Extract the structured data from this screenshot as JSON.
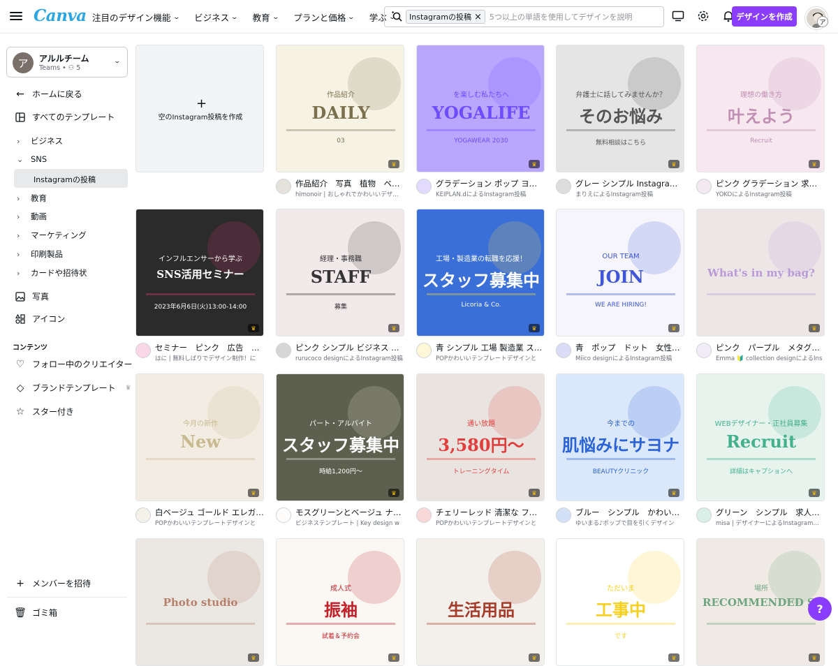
{
  "header": {
    "logo": "Canva",
    "nav": [
      "注目のデザイン機能",
      "ビジネス",
      "教育",
      "プランと価格",
      "学ぶ"
    ],
    "search_chip": "Instagramの投稿",
    "search_placeholder": "5つ以上の単語を使用してデザインを説明",
    "create_button": "デザインを作成",
    "avatar_badge": "ア"
  },
  "sidebar": {
    "team_initial": "ア",
    "team_name": "アルルチーム",
    "team_sub": "Teams • ",
    "team_members": "5",
    "back": "ホームに戻る",
    "all_templates": "すべてのテンプレート",
    "categories": [
      "ビジネス",
      "SNS"
    ],
    "active": "Instagramの投稿",
    "categories2": [
      "教育",
      "動画",
      "マーケティング",
      "印刷製品",
      "カードや招待状"
    ],
    "photos": "写真",
    "icons": "アイコン",
    "content_heading": "コンテンツ",
    "following": "フォロー中のクリエイター",
    "brand_templates": "ブランドテンプレート",
    "starred": "スター付き",
    "invite": "メンバーを招待",
    "trash": "ゴミ箱"
  },
  "blank": {
    "label": "空のInstagram投稿を作成"
  },
  "cards": [
    {
      "title": "作品紹介　写真　植物　ベージュ",
      "sub": "himonoir | おしゃれでかわいいデザイン",
      "bg": "#f6f3e4",
      "text": "DAILY",
      "sub_text": "作品紹介",
      "num": "03",
      "accent": "#7c6f4e"
    },
    {
      "title": "グラデーション ポップ ヨガ キャンペーン",
      "sub": "KEIPLAN.dによるInstagram投稿",
      "bg": "#b9a6ff",
      "text": "YOGALIFE",
      "sub_text": "を楽しむ私たちへ",
      "num": "YOGAWEAR 2030",
      "accent": "#6d4cff"
    },
    {
      "title": "グレー シンプル Instagram投稿",
      "sub": "まりえによるInstagram投稿",
      "bg": "#e5e5e5",
      "text": "そのお悩み",
      "sub_text": "弁護士に話してみませんか？",
      "num": "無料相談はこちら",
      "accent": "#555555"
    },
    {
      "title": "ピンク グラデーション 求人 Instagram",
      "sub": "YOKOによるInstagram投稿",
      "bg": "#f7e7ef",
      "text": "叶えよう",
      "sub_text": "理想の働き方",
      "num": "Recruit",
      "accent": "#c28fb5"
    },
    {
      "title": "セミナー　ピンク　広告　インフル",
      "sub": "はに | 無料しばりでデザイン制作！に",
      "bg": "#2b2b2b",
      "text": "SNS活用セミナー",
      "sub_text": "インフルエンサーから学ぶ",
      "num": "2023年6月6日(火)13:00-14:00",
      "accent": "#e0387c"
    },
    {
      "title": "ピンク シンプル ビジネス 求人広告",
      "sub": "rurucoco designによるInstagram投稿",
      "bg": "#f1e9ea",
      "text": "STAFF",
      "sub_text": "経理・事務職",
      "num": "募集",
      "accent": "#333333"
    },
    {
      "title": "青 シンプル 工場 製造業 スタッフ募集",
      "sub": "POPかわいいテンプレートデザインと",
      "bg": "#3a6fd8",
      "text": "スタッフ募集中",
      "sub_text": "工場・製造業の転職を応援！",
      "num": "Licoria & Co.",
      "accent": "#ffd93d"
    },
    {
      "title": "青　ポップ　ドット　女性のイラスト",
      "sub": "Miico designによるInstagram投稿",
      "bg": "#f5f5fb",
      "text": "JOIN",
      "sub_text": "OUR TEAM",
      "num": "WE ARE HIRING!",
      "accent": "#3f56d8"
    },
    {
      "title": "ピンク　パープル　メタグラデーション",
      "sub": "Emma 🔰 collection designによるIns",
      "bg": "#ede6e6",
      "text": "What's in my bag?",
      "sub_text": "",
      "num": "",
      "accent": "#b99bd8"
    },
    {
      "title": "白ベージュ ゴールド エレガント ジュエリー",
      "sub": "POPかわいいテンプレートデザインと",
      "bg": "#f3ece2",
      "text": "New",
      "sub_text": "今月の新作",
      "num": "",
      "accent": "#c8b98f"
    },
    {
      "title": "モスグリーンとベージュ ナチュラル",
      "sub": "ビジネステンプレート | Key design w",
      "bg": "#5d604f",
      "text": "スタッフ募集中",
      "sub_text": "パート・アルバイト",
      "num": "時給1,200円〜",
      "accent": "#f3efe4"
    },
    {
      "title": "チェリーレッド 清潔な フィットネス",
      "sub": "POPかわいいテンプレートデザインと",
      "bg": "#e9e4df",
      "text": "3,580円〜",
      "sub_text": "通い放題",
      "num": "トレーニングタイム",
      "accent": "#e23e3e"
    },
    {
      "title": "ブルー　シンプル　かわいい　美容",
      "sub": "ゆいまる♪ポップで目を引くデザイン",
      "bg": "#dbe7fb",
      "text": "肌悩みにサヨナラ",
      "sub_text": "今までの",
      "num": "BEAUTYクリニック",
      "accent": "#2a63d6"
    },
    {
      "title": "グリーン　シンプル　求人募集　Inst",
      "sub": "misa | デザイナーによるInstagram投稿",
      "bg": "#e7f4ee",
      "text": "Recruit",
      "sub_text": "WEBデザイナー・正社員募集",
      "num": "詳細はキャプションへ",
      "accent": "#43b08e"
    },
    {
      "title": "",
      "sub": "",
      "bg": "#ebe7e3",
      "text": "Photo studio",
      "sub_text": "",
      "num": "",
      "accent": "#b6806b"
    },
    {
      "title": "",
      "sub": "",
      "bg": "#fbf7f2",
      "text": "振袖",
      "sub_text": "成人式",
      "num": "試着＆予約会",
      "accent": "#c4202a"
    },
    {
      "title": "",
      "sub": "",
      "bg": "#f3efea",
      "text": "生活用品",
      "sub_text": "",
      "num": "",
      "accent": "#a63b29"
    },
    {
      "title": "",
      "sub": "",
      "bg": "#fff",
      "text": "工事中",
      "sub_text": "ただいま",
      "num": "です",
      "accent": "#f7cf1d"
    },
    {
      "title": "",
      "sub": "",
      "bg": "#efeae4",
      "text": "RECOMMENDED SPOT",
      "sub_text": "場所",
      "num": "",
      "accent": "#6fa681"
    }
  ],
  "help": "?"
}
